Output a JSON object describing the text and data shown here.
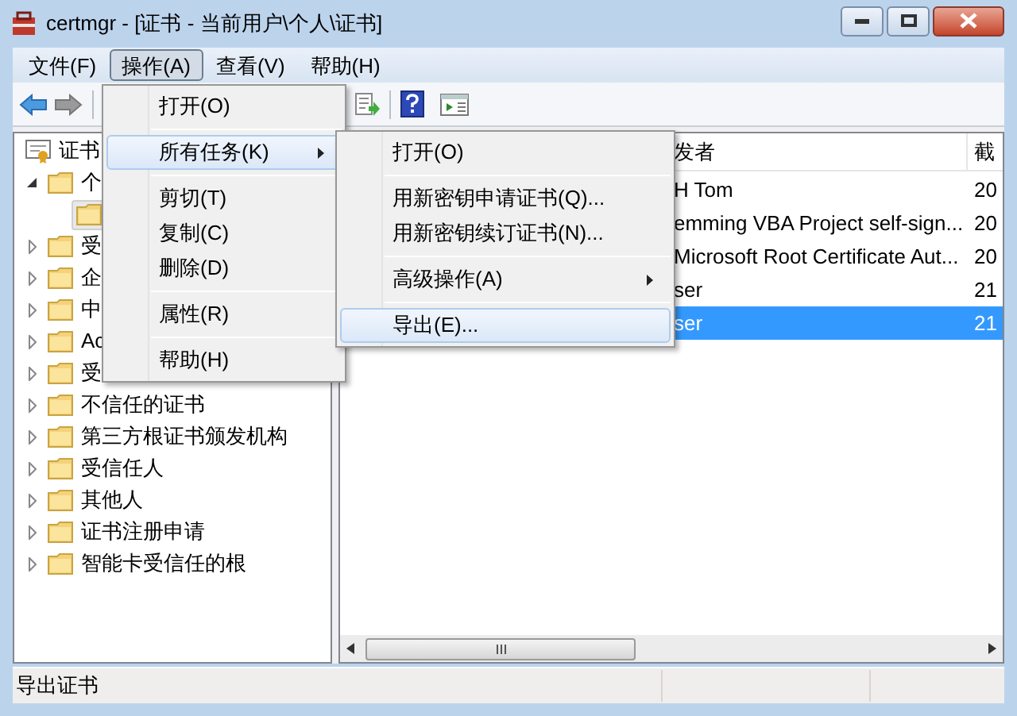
{
  "window": {
    "title": "certmgr - [证书 - 当前用户\\个人\\证书]"
  },
  "menu_bar": [
    {
      "label": "文件(F)",
      "selected": false
    },
    {
      "label": "操作(A)",
      "selected": true
    },
    {
      "label": "查看(V)",
      "selected": false
    },
    {
      "label": "帮助(H)",
      "selected": false
    }
  ],
  "tree": [
    {
      "label": "证书",
      "children": [
        {
          "label": "个",
          "expanded": true,
          "children": [
            {
              "selected": true
            }
          ]
        },
        {
          "label": "受",
          "expanded": false
        },
        {
          "label": "企",
          "expanded": false
        },
        {
          "label": "中",
          "expanded": false
        },
        {
          "label": "Ac",
          "expanded": false
        },
        {
          "label": "受",
          "expanded": false
        },
        {
          "label": "不信任的证书",
          "expanded": false
        },
        {
          "label": "第三方根证书颁发机构",
          "expanded": false
        },
        {
          "label": "受信任人",
          "expanded": false
        },
        {
          "label": "其他人",
          "expanded": false
        },
        {
          "label": "证书注册申请",
          "expanded": false
        },
        {
          "label": "智能卡受信任的根",
          "expanded": false
        }
      ]
    }
  ],
  "list": {
    "columns": [
      "发者",
      "截"
    ],
    "rows": [
      {
        "cells": [
          "H Tom",
          "20"
        ],
        "selected": false
      },
      {
        "cells": [
          "emming VBA Project self-sign...",
          "20"
        ],
        "selected": false
      },
      {
        "cells": [
          "Microsoft Root Certificate Aut...",
          "20"
        ],
        "selected": false
      },
      {
        "cells": [
          "ser",
          "21"
        ],
        "selected": false
      },
      {
        "cells": [
          "ser",
          "21"
        ],
        "selected": true
      }
    ]
  },
  "context_menu": {
    "items": [
      {
        "kind": "item",
        "label": "打开(O)",
        "selected": false
      },
      {
        "kind": "separator"
      },
      {
        "kind": "submenu",
        "label": "所有任务(K)",
        "selected": true
      },
      {
        "kind": "separator"
      },
      {
        "kind": "item",
        "label": "剪切(T)",
        "selected": false
      },
      {
        "kind": "item",
        "label": "复制(C)",
        "selected": false
      },
      {
        "kind": "item",
        "label": "删除(D)",
        "selected": false
      },
      {
        "kind": "separator"
      },
      {
        "kind": "item",
        "label": "属性(R)",
        "selected": false
      },
      {
        "kind": "separator"
      },
      {
        "kind": "item",
        "label": "帮助(H)",
        "selected": false
      }
    ]
  },
  "submenu": {
    "items": [
      {
        "kind": "item",
        "label": "打开(O)",
        "selected": false
      },
      {
        "kind": "separator"
      },
      {
        "kind": "item",
        "label": "用新密钥申请证书(Q)...",
        "selected": false
      },
      {
        "kind": "item",
        "label": "用新密钥续订证书(N)...",
        "selected": false
      },
      {
        "kind": "separator"
      },
      {
        "kind": "submenu",
        "label": "高级操作(A)",
        "selected": false
      },
      {
        "kind": "separator"
      },
      {
        "kind": "item",
        "label": "导出(E)...",
        "selected": true
      }
    ]
  },
  "status_bar": {
    "text": "导出证书"
  }
}
